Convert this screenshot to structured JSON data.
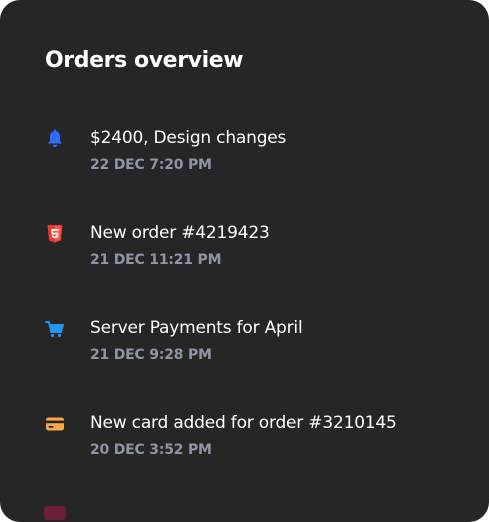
{
  "card": {
    "title": "Orders overview"
  },
  "timeline": [
    {
      "icon": "notification-bell-icon",
      "icon_color": "#2f6bff",
      "label": "$2400, Design changes",
      "date": "22 DEC 7:20 PM"
    },
    {
      "icon": "html5-icon",
      "icon_color": "#e53935",
      "label": "New order #4219423",
      "date": "21 DEC 11:21 PM"
    },
    {
      "icon": "shopping-cart-icon",
      "icon_color": "#2196f3",
      "label": "Server Payments for April",
      "date": "21 DEC 9:28 PM"
    },
    {
      "icon": "credit-card-icon",
      "icon_color": "#f9a84a",
      "label": "New card added for order #3210145",
      "date": "20 DEC 3:52 PM"
    }
  ],
  "colors": {
    "card_background": "#262626",
    "text_primary": "#ffffff",
    "text_secondary": "#8f94a6"
  }
}
